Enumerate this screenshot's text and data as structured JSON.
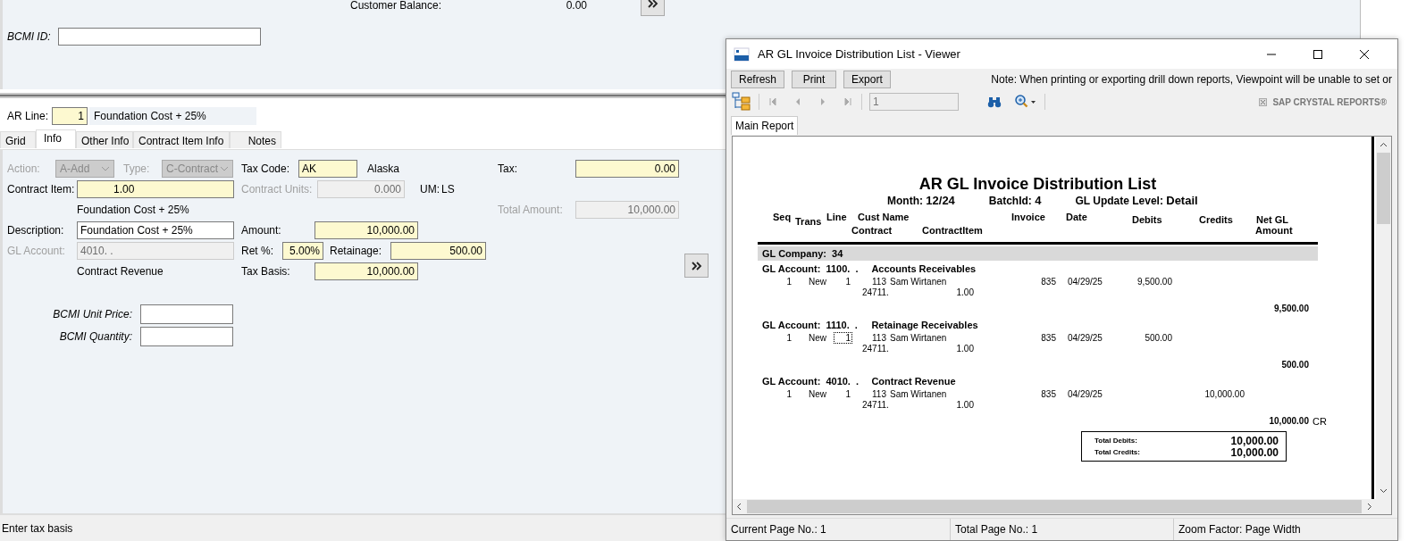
{
  "app": {
    "customer_balance": {
      "label": "Customer Balance:",
      "value": "0.00"
    },
    "bcmi_id": {
      "label": "BCMI ID:"
    },
    "ar_line": {
      "label": "AR Line:",
      "value": "1",
      "description": "Foundation Cost + 25%"
    },
    "tabs": [
      {
        "label": "Grid",
        "selected": false
      },
      {
        "label": "Info",
        "selected": true
      },
      {
        "label": "Other Info",
        "selected": false
      },
      {
        "label": "Contract Item Info",
        "selected": false
      },
      {
        "label": "Notes",
        "selected": false
      }
    ],
    "form": {
      "action": {
        "label": "Action:",
        "value": "A-Add",
        "disabled": true
      },
      "type": {
        "label": "Type:",
        "value": "C-Contract",
        "disabled": true
      },
      "tax_code": {
        "label": "Tax Code:",
        "value": "AK",
        "disabled": false,
        "required": true
      },
      "tax_code_name": "Alaska",
      "tax": {
        "label": "Tax:",
        "value": "0.00",
        "disabled": false,
        "required": true
      },
      "contract_item": {
        "label": "Contract Item:",
        "value": "1.00",
        "disabled": false,
        "required": true
      },
      "contract_units": {
        "label": "Contract Units:",
        "value": "0.000",
        "disabled": true
      },
      "um": {
        "label": "UM:",
        "value": "LS"
      },
      "item_description": "Foundation Cost + 25%",
      "total_amount": {
        "label": "Total Amount:",
        "value": "10,000.00",
        "disabled": true
      },
      "description": {
        "label": "Description:",
        "value": "Foundation Cost + 25%",
        "disabled": false,
        "required": false
      },
      "amount": {
        "label": "Amount:",
        "value": "10,000.00",
        "disabled": false,
        "required": true
      },
      "gl_account": {
        "label": "GL Account:",
        "value": "4010.  .",
        "disabled": true
      },
      "ret_pct": {
        "label": "Ret %:",
        "value": "5.00%",
        "disabled": false,
        "required": true
      },
      "retainage": {
        "label": "Retainage:",
        "value": "500.00",
        "disabled": false,
        "required": true
      },
      "gl_account_name": "Contract Revenue",
      "tax_basis": {
        "label": "Tax Basis:",
        "value": "10,000.00",
        "disabled": false,
        "required": true
      },
      "bcmi_unit_price": {
        "label": "BCMI Unit Price:"
      },
      "bcmi_quantity": {
        "label": "BCMI Quantity:"
      }
    },
    "status_bar": "Enter tax basis"
  },
  "viewer": {
    "title": "AR GL Invoice Distribution List - Viewer",
    "buttons": [
      "Refresh",
      "Print",
      "Export"
    ],
    "note": "Note: When printing or exporting drill down reports, Viewpoint will be unable to set or",
    "page_field": "1",
    "brand": "SAP CRYSTAL REPORTS®",
    "tabs": [
      {
        "label": "Main Report",
        "selected": true
      }
    ],
    "report": {
      "title": "AR GL Invoice Distribution List",
      "params": [
        {
          "label": "Month:",
          "value": "12/24"
        },
        {
          "label": "BatchId:",
          "value": "4"
        },
        {
          "label": "GL Update Level:",
          "value": "Detail"
        }
      ],
      "headers_1": [
        "Seq",
        "Trans",
        "Line",
        "Cust Name",
        "Invoice",
        "Date",
        "Debits",
        "Credits",
        "Net GL"
      ],
      "headers_2": [
        "Contract",
        "ContractItem",
        "Amount"
      ],
      "company": {
        "label": "GL Company:",
        "value": "34"
      },
      "accounts": [
        {
          "label": "GL Account:",
          "number": "1100.  .",
          "name": "Accounts Receivables",
          "total": "9,500.00",
          "rows": [
            {
              "seq": "1",
              "trans": "New",
              "line": "1",
              "line_focused": false,
              "cust": "113",
              "cust_name": "Sam Wirtanen",
              "invoice": "835",
              "date": "04/29/25",
              "debit": "9,500.00",
              "contract": "24711.",
              "contract_item": "1.00"
            }
          ]
        },
        {
          "label": "GL Account:",
          "number": "1110.  .",
          "name": "Retainage Receivables",
          "total": "500.00",
          "rows": [
            {
              "seq": "1",
              "trans": "New",
              "line": "1",
              "line_focused": true,
              "cust": "113",
              "cust_name": "Sam Wirtanen",
              "invoice": "835",
              "date": "04/29/25",
              "debit": "500.00",
              "contract": "24711.",
              "contract_item": "1.00"
            }
          ]
        },
        {
          "label": "GL Account:",
          "number": "4010.  .",
          "name": "Contract Revenue",
          "total": "10,000.00",
          "total_suffix": "CR",
          "rows": [
            {
              "seq": "1",
              "trans": "New",
              "line": "1",
              "line_focused": false,
              "cust": "113",
              "cust_name": "Sam Wirtanen",
              "invoice": "835",
              "date": "04/29/25",
              "credit": "10,000.00",
              "contract": "24711.",
              "contract_item": "1.00"
            }
          ]
        }
      ],
      "totals": [
        {
          "label": "Total Debits:",
          "value": "10,000.00"
        },
        {
          "label": "Total Credits:",
          "value": "10,000.00"
        }
      ]
    },
    "status_bar": [
      "Current Page No.: 1",
      "Total Page No.: 1",
      "Zoom Factor: Page Width"
    ]
  }
}
